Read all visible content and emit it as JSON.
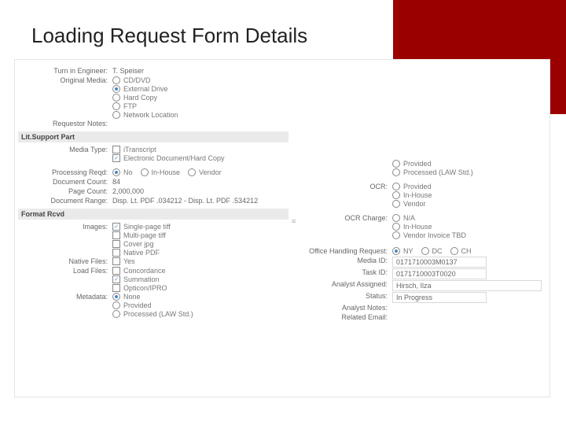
{
  "title": "Loading Request Form Details",
  "top": {
    "engLabel": "Turn in Engineer:",
    "engValue": "T. Speiser",
    "mediaLabel": "Original Media:",
    "media": {
      "cd": "CD/DVD",
      "ext": "External Drive",
      "hc": "Hard Copy",
      "ftp": "FTP",
      "net": "Network Location"
    },
    "reqNotesLabel": "Requestor Notes:"
  },
  "sectionLit": "Lit.Support Part",
  "lit": {
    "mediaTypeLabel": "Media Type:",
    "mediaType": {
      "itran": "iTranscript",
      "edhc": "Electronic Document/Hard Copy"
    },
    "procLabel": "Processing Reqd:",
    "proc": {
      "no": "No",
      "inh": "In-House",
      "ven": "Vendor"
    },
    "docCountLabel": "Document Count:",
    "docCount": "84",
    "pageCountLabel": "Page Count:",
    "pageCount": "2,000,000",
    "docRangeLabel": "Document Range:",
    "docRange": "Disp. Lt. PDF .034212 - Disp. Lt. PDF .534212"
  },
  "sectionFmt": "Format Rcvd",
  "fmt": {
    "imagesLabel": "Images:",
    "images": {
      "sp": "Single-page tiff",
      "mp": "Multi-page tiff",
      "cov": "Cover jpg",
      "npdf": "Native PDF"
    },
    "nativeLabel": "Native Files:",
    "native": "Yes",
    "loadLabel": "Load Files:",
    "load": {
      "conc": "Concordance",
      "summ": "Summation",
      "opt": "Opticon/IPRO"
    },
    "metaLabel": "Metadata:",
    "meta": {
      "none": "None",
      "prov": "Provided",
      "proc": "Processed (LAW Std.)"
    }
  },
  "right": {
    "rMetaHide": "",
    "rMeta": {
      "prov": "Provided",
      "proc": "Processed (LAW Std.)"
    },
    "ocrLabel": "OCR:",
    "ocr": {
      "prov": "Provided",
      "inh": "In-House",
      "ven": "Vendor"
    },
    "ocrChargeLabel": "OCR Charge:",
    "ocrCharge": {
      "na": "N/A",
      "inh": "In-House",
      "vtbd": "Vendor Invoice TBD"
    },
    "officeLabel": "Office Handling Request:",
    "office": {
      "ny": "NY",
      "dc": "DC",
      "ch": "CH"
    },
    "mediaIdLabel": "Media ID:",
    "mediaId": "0171710003M0137",
    "taskIdLabel": "Task ID:",
    "taskId": "0171710003T0020",
    "analystLabel": "Analyst Assigned:",
    "analyst": "Hirsch, Ilza",
    "statusLabel": "Status:",
    "status": "In Progress",
    "analystNotesLabel": "Analyst Notes:",
    "relEmailLabel": "Related Email:"
  }
}
